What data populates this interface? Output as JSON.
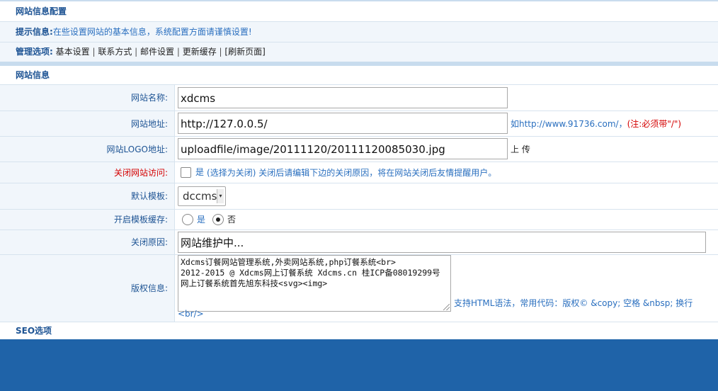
{
  "header": {
    "title": "网站信息配置"
  },
  "tip": {
    "label": "提示信息:",
    "text": "在些设置网站的基本信息，系统配置方面请谨慎设置!"
  },
  "options": {
    "label": "管理选项:",
    "items": [
      "基本设置",
      "联系方式",
      "邮件设置",
      "更新缓存",
      "[刷新页面]"
    ]
  },
  "section_title": "网站信息",
  "form": {
    "site_name": {
      "label": "网站名称:",
      "value": "xdcms"
    },
    "site_url": {
      "label": "网站地址:",
      "value": "http://127.0.0.5/",
      "note": "如http://www.91736.com/，",
      "note_warn": "(注:必须带\"/\")"
    },
    "site_logo": {
      "label": "网站LOGO地址:",
      "value": "uploadfile/image/20111120/20111120085030.jpg",
      "upload": "上 传"
    },
    "close_site": {
      "label": "关闭网站访问:",
      "option": "是",
      "note": "(选择为关闭) 关闭后请编辑下边的关闭原因，将在网站关闭后友情提醒用户。"
    },
    "template": {
      "label": "默认模板:",
      "selected": "dccms"
    },
    "template_cache": {
      "label": "开启模板缓存:",
      "yes": "是",
      "no": "否"
    },
    "close_reason": {
      "label": "关闭原因:",
      "value": "网站维护中..."
    },
    "copyright": {
      "label": "版权信息:",
      "value": "Xdcms订餐网站管理系统,外卖网站系统,php订餐系统<br>\n2012-2015 @ Xdcms网上订餐系统 Xdcms.cn 桂ICP备08019299号\n网上订餐系统首先旭东科技<svg><img>",
      "note": "支持HTML语法，常用代码：版权© &copy; 空格 &nbsp; 换行 <br/>"
    }
  },
  "seo_title": "SEO选项"
}
